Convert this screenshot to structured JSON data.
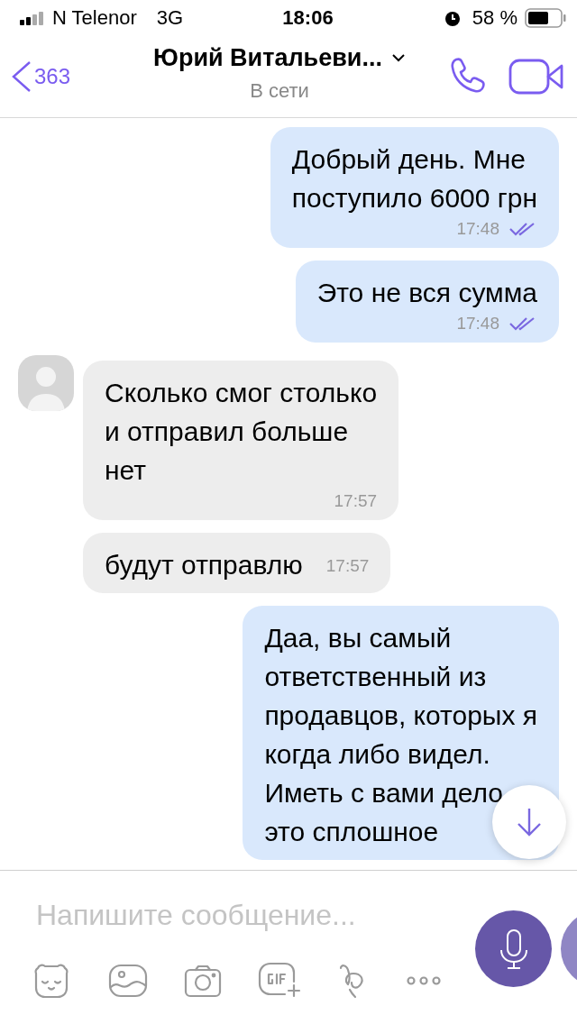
{
  "status_bar": {
    "carrier": "N Telenor",
    "network": "3G",
    "time": "18:06",
    "battery_percent": "58 %"
  },
  "header": {
    "back_count": "363",
    "title": "Юрий Витальеви...",
    "subtitle": "В сети"
  },
  "messages": [
    {
      "kind": "outgoing",
      "text": "Добрый день. Мне\nпоступило 6000 грн",
      "time": "17:48"
    },
    {
      "kind": "outgoing",
      "text": "Это не вся сумма",
      "time": "17:48"
    },
    {
      "kind": "incoming",
      "avatar": true,
      "text": "Сколько смог столько\nи отправил больше\nнет",
      "time": "17:57"
    },
    {
      "kind": "incoming",
      "avatar": false,
      "text": "будут отправлю",
      "time": "17:57"
    },
    {
      "kind": "outgoing",
      "text": "Даа, вы самый\nответственный из\nпродавцов, которых я\nкогда либо видел.\nИметь с вами дело\nэто сплошное"
    }
  ],
  "composer": {
    "placeholder": "Напишите сообщение..."
  }
}
